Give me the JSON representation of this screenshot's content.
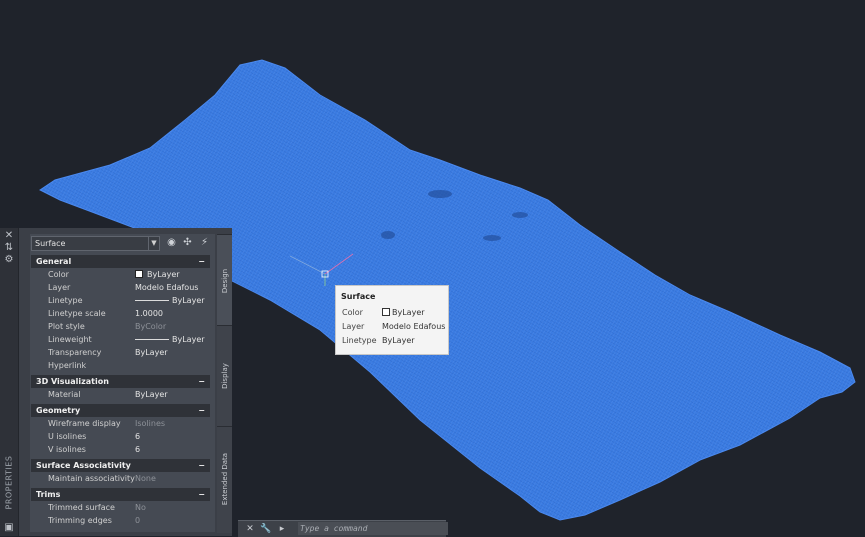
{
  "palette": {
    "vertical_label": "PROPERTIES",
    "object_select": "Surface",
    "sections": [
      {
        "title": "General",
        "toggle": "−",
        "rows": [
          {
            "name": "Color",
            "value": "ByLayer",
            "swatch": true
          },
          {
            "name": "Layer",
            "value": "Modelo Edafous"
          },
          {
            "name": "Linetype",
            "value": "ByLayer",
            "line": true
          },
          {
            "name": "Linetype scale",
            "value": "1.0000"
          },
          {
            "name": "Plot style",
            "value": "ByColor",
            "dim": true
          },
          {
            "name": "Lineweight",
            "value": "ByLayer",
            "line": true
          },
          {
            "name": "Transparency",
            "value": "ByLayer"
          },
          {
            "name": "Hyperlink",
            "value": ""
          }
        ]
      },
      {
        "title": "3D Visualization",
        "toggle": "−",
        "rows": [
          {
            "name": "Material",
            "value": "ByLayer"
          }
        ]
      },
      {
        "title": "Geometry",
        "toggle": "−",
        "rows": [
          {
            "name": "Wireframe display",
            "value": "Isolines",
            "dim": true
          },
          {
            "name": "U isolines",
            "value": "6"
          },
          {
            "name": "V isolines",
            "value": "6"
          }
        ]
      },
      {
        "title": "Surface Associativity",
        "toggle": "−",
        "rows": [
          {
            "name": "Maintain associativity",
            "value": "None",
            "dim": true
          }
        ]
      },
      {
        "title": "Trims",
        "toggle": "−",
        "rows": [
          {
            "name": "Trimmed surface",
            "value": "No",
            "dim": true
          },
          {
            "name": "Trimming edges",
            "value": "0",
            "dim": true
          }
        ]
      }
    ],
    "tabs": [
      "Design",
      "Display",
      "Extended Data"
    ]
  },
  "tooltip": {
    "title": "Surface",
    "rows": [
      {
        "key": "Color",
        "value": "ByLayer"
      },
      {
        "key": "Layer",
        "value": "Modelo Edafous"
      },
      {
        "key": "Linetype",
        "value": "ByLayer"
      }
    ]
  },
  "command": {
    "placeholder": "Type a command"
  },
  "colors": {
    "background": "#1f232b",
    "mesh": "#3a7be0",
    "palette": "#3b3f47"
  },
  "icons": [
    "close-icon",
    "autohide-icon",
    "settings-icon",
    "quick-select-icon",
    "select-objects-icon",
    "toggle-pickadd-icon",
    "wrench-icon",
    "command-prompt-icon"
  ]
}
